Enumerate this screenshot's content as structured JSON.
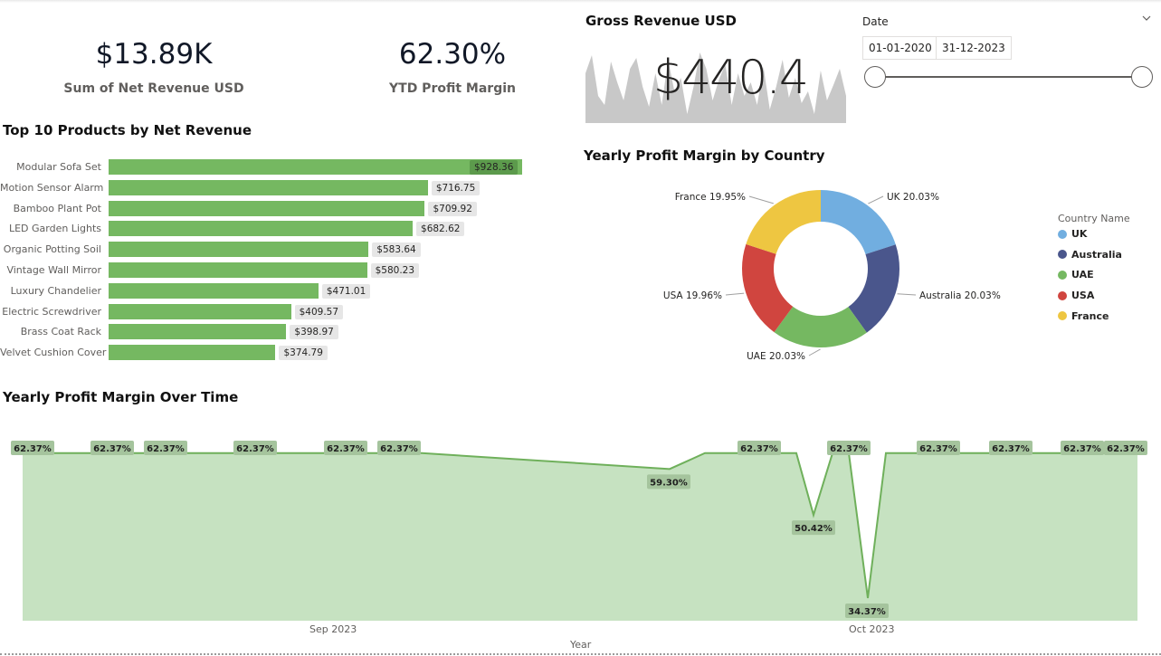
{
  "kpis": {
    "net_revenue": {
      "value": "$13.89K",
      "label": "Sum of Net Revenue USD"
    },
    "profit_margin": {
      "value": "62.30%",
      "label": "YTD Profit Margin"
    }
  },
  "gross_revenue": {
    "title": "Gross Revenue USD",
    "value": "$440.4"
  },
  "date_slicer": {
    "label": "Date",
    "start": "01-01-2020",
    "end": "31-12-2023"
  },
  "colors": {
    "bar": "#75b861",
    "area_fill": "#c6e2c1",
    "area_line": "#6fb05b",
    "sparkline": "#c8c8c8",
    "uk": "#71aee0",
    "australia": "#4a568c",
    "uae": "#75b861",
    "usa": "#d0453f",
    "france": "#eec641"
  },
  "chart_data": [
    {
      "type": "bar",
      "orientation": "horizontal",
      "title": "Top 10 Products by Net Revenue",
      "categories": [
        "Modular Sofa Set",
        "Motion Sensor Alarm",
        "Bamboo Plant Pot",
        "LED Garden Lights",
        "Organic Potting Soil",
        "Vintage Wall Mirror",
        "Luxury Chandelier",
        "Electric Screwdriver",
        "Brass Coat Rack",
        "Velvet Cushion Cover"
      ],
      "values": [
        928.36,
        716.75,
        709.92,
        682.62,
        583.64,
        580.23,
        471.01,
        409.57,
        398.97,
        374.79
      ],
      "labels": [
        "$928.36",
        "$716.75",
        "$709.92",
        "$682.62",
        "$583.64",
        "$580.23",
        "$471.01",
        "$409.57",
        "$398.97",
        "$374.79"
      ]
    },
    {
      "type": "pie",
      "donut": true,
      "title": "Yearly Profit Margin by Country",
      "legend_title": "Country Name",
      "legend_position": "right",
      "slices": [
        {
          "name": "UK",
          "value": 20.03,
          "label": "UK 20.03%",
          "color": "#71aee0"
        },
        {
          "name": "Australia",
          "value": 20.03,
          "label": "Australia 20.03%",
          "color": "#4a568c"
        },
        {
          "name": "UAE",
          "value": 20.03,
          "label": "UAE 20.03%",
          "color": "#75b861"
        },
        {
          "name": "USA",
          "value": 19.96,
          "label": "USA 19.96%",
          "color": "#d0453f"
        },
        {
          "name": "France",
          "value": 19.95,
          "label": "France 19.95%",
          "color": "#eec641"
        }
      ]
    },
    {
      "type": "area",
      "title": "Yearly Profit Margin Over Time",
      "xlabel": "Year",
      "x_ticks": [
        "Sep 2023",
        "Oct 2023"
      ],
      "ylim": [
        30,
        66
      ],
      "points": [
        62.37,
        62.37,
        62.37,
        62.37,
        62.37,
        62.37,
        62.37,
        62.37,
        62.37,
        62.37,
        59.3,
        62.37,
        62.37,
        62.37,
        50.42,
        62.37,
        62.37,
        34.37,
        62.37,
        62.37,
        62.37,
        62.37,
        62.37,
        62.37,
        62.37,
        62.37
      ],
      "data_labels": [
        {
          "index": 0,
          "text": "62.37%"
        },
        {
          "index": 2,
          "text": "62.37%"
        },
        {
          "index": 3,
          "text": "62.37%"
        },
        {
          "index": 5,
          "text": "62.37%"
        },
        {
          "index": 7,
          "text": "62.37%"
        },
        {
          "index": 8,
          "text": "62.37%"
        },
        {
          "index": 10,
          "text": "59.30%"
        },
        {
          "index": 12,
          "text": "62.37%"
        },
        {
          "index": 14,
          "text": "50.42%"
        },
        {
          "index": 16,
          "text": "62.37%"
        },
        {
          "index": 17,
          "text": "34.37%"
        },
        {
          "index": 19,
          "text": "62.37%"
        },
        {
          "index": 21,
          "text": "62.37%"
        },
        {
          "index": 23,
          "text": "62.37%"
        },
        {
          "index": 25,
          "text": "62.37%"
        }
      ]
    }
  ]
}
